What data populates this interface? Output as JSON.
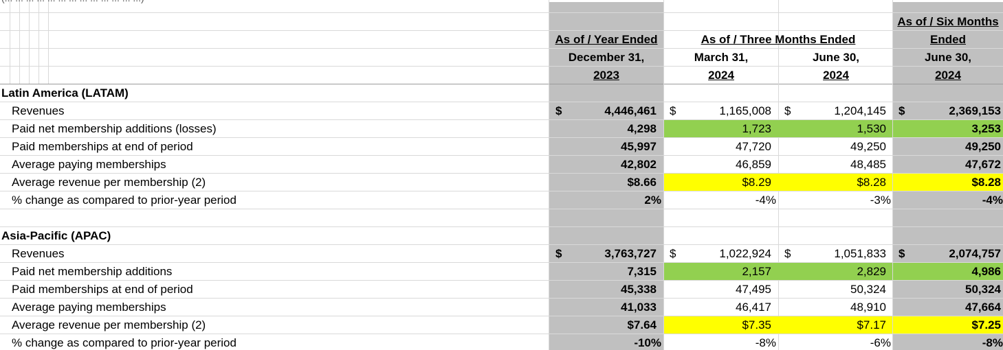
{
  "top_clipped_text": "(... ... ... ... ... ... ... ... ... ... ... ... ...)",
  "headers": {
    "year_ended": {
      "line1": "As of / Year Ended",
      "line2": "December 31,",
      "line3": "2023"
    },
    "three_months": {
      "line1": "As of / Three Months Ended"
    },
    "mar": {
      "line1": "March 31,",
      "line2": "2024"
    },
    "jun": {
      "line1": "June 30,",
      "line2": "2024"
    },
    "six_months": {
      "line1": "As of / Six Months",
      "line2": "Ended",
      "line3": "June 30,",
      "line4": "2024"
    }
  },
  "currency_symbol": "$",
  "sections": [
    {
      "title": "Latin America (LATAM)",
      "rows": [
        {
          "label": "Revenues",
          "fy": "4,446,461",
          "q1": "1,165,008",
          "q2": "1,204,145",
          "h1": "2,369,153"
        },
        {
          "label": "Paid net membership additions (losses)",
          "fy": "4,298",
          "q1": "1,723",
          "q2": "1,530",
          "h1": "3,253"
        },
        {
          "label": "Paid memberships at end of period",
          "fy": "45,997",
          "q1": "47,720",
          "q2": "49,250",
          "h1": "49,250"
        },
        {
          "label": "Average paying memberships",
          "fy": "42,802",
          "q1": "46,859",
          "q2": "48,485",
          "h1": "47,672"
        },
        {
          "label": "Average revenue per membership (2)",
          "fy": "$8.66",
          "q1": "$8.29",
          "q2": "$8.28",
          "h1": "$8.28"
        },
        {
          "label": "% change as compared to prior-year period",
          "fy": "2%",
          "q1": "-4%",
          "q2": "-3%",
          "h1": "-4%"
        }
      ]
    },
    {
      "title": "Asia-Pacific (APAC)",
      "rows": [
        {
          "label": "Revenues",
          "fy": "3,763,727",
          "q1": "1,022,924",
          "q2": "1,051,833",
          "h1": "2,074,757"
        },
        {
          "label": "Paid net membership additions",
          "fy": "7,315",
          "q1": "2,157",
          "q2": "2,829",
          "h1": "4,986"
        },
        {
          "label": "Paid memberships at end of period",
          "fy": "45,338",
          "q1": "47,495",
          "q2": "50,324",
          "h1": "50,324"
        },
        {
          "label": "Average paying memberships",
          "fy": "41,033",
          "q1": "46,417",
          "q2": "48,910",
          "h1": "47,664"
        },
        {
          "label": "Average revenue per membership (2)",
          "fy": "$7.64",
          "q1": "$7.35",
          "q2": "$7.17",
          "h1": "$7.25"
        },
        {
          "label": "% change as compared to prior-year period",
          "fy": "-10%",
          "q1": "-8%",
          "q2": "-6%",
          "h1": "-8%"
        }
      ]
    }
  ],
  "colors": {
    "shade": "#c0c0c0",
    "green": "#92d050",
    "yellow": "#ffff00",
    "grid": "#d9d9d9"
  }
}
